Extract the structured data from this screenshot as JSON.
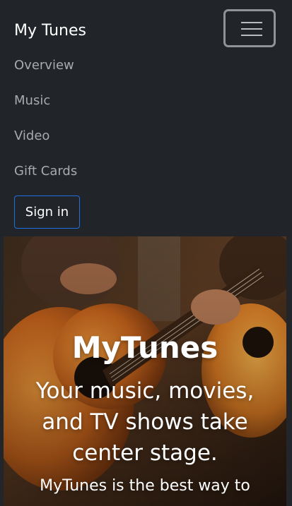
{
  "navbar": {
    "brand": "My Tunes",
    "toggler_icon": "hamburger-menu-icon",
    "links": [
      {
        "label": "Overview"
      },
      {
        "label": "Music"
      },
      {
        "label": "Video"
      },
      {
        "label": "Gift Cards"
      }
    ],
    "signin_label": "Sign in",
    "colors": {
      "background": "#212529",
      "link": "#a7aaae",
      "signin_border": "#1e6fe0"
    }
  },
  "hero": {
    "title": "MyTunes",
    "subtitle": "Your music, movies, and TV shows take center stage.",
    "description": "MyTunes is the best way to"
  }
}
